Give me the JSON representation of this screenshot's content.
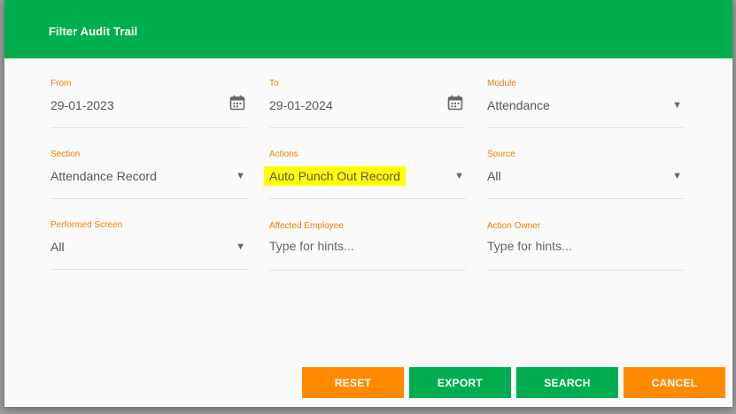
{
  "dialog": {
    "title": "Filter Audit Trail"
  },
  "fields": {
    "from": {
      "label": "From",
      "value": "29-01-2023",
      "icon": "calendar-icon"
    },
    "to": {
      "label": "To",
      "value": "29-01-2024",
      "icon": "calendar-icon"
    },
    "module": {
      "label": "Module",
      "value": "Attendance"
    },
    "section": {
      "label": "Section",
      "value": "Attendance Record"
    },
    "actions": {
      "label": "Actions",
      "value": "Auto Punch Out Record"
    },
    "source": {
      "label": "Source",
      "value": "All"
    },
    "performed_screen": {
      "label": "Performed Screen",
      "value": "All"
    },
    "affected_employee": {
      "label": "Affected Employee",
      "placeholder": "Type for hints..."
    },
    "action_owner": {
      "label": "Action Owner",
      "placeholder": "Type for hints..."
    }
  },
  "buttons": {
    "reset": "RESET",
    "export": "EXPORT",
    "search": "SEARCH",
    "cancel": "CANCEL"
  },
  "colors": {
    "header": "#00ad4f",
    "label": "#ef7d00",
    "orange_button": "#ff8a00",
    "green_button": "#00ad4f",
    "highlight": "#ffff00"
  },
  "caret_glyph": "▼"
}
